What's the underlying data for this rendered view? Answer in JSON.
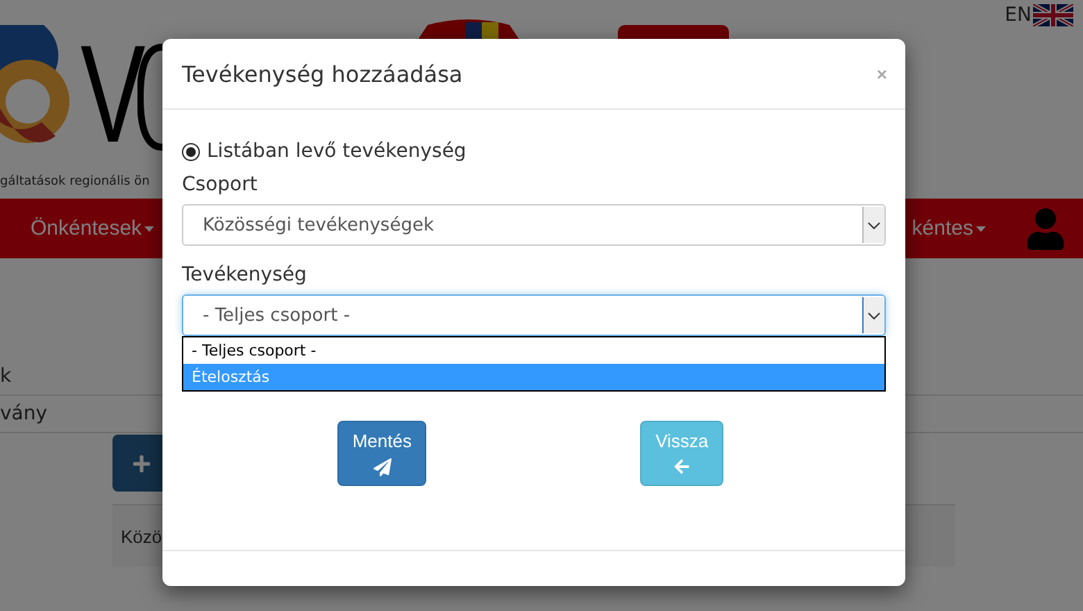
{
  "page": {
    "language": "EN",
    "logo_text": "V",
    "tagline": "gáltatások regionális ön",
    "nav": [
      {
        "label": "Önkéntesek"
      },
      {
        "label": "kéntes"
      }
    ],
    "rows": [
      "k",
      "vány"
    ],
    "panel_text": "Közö"
  },
  "dialog": {
    "title": "Tevékenység hozzáadása",
    "close": "×",
    "radio": {
      "label": "Listában levő tevékenység",
      "selected": true
    },
    "fields": [
      {
        "label": "Csoport",
        "value": "Közösségi tevékenységek",
        "focused": false
      },
      {
        "label": "Tevékenység",
        "value": "- Teljes csoport -",
        "focused": true,
        "options": [
          {
            "label": "- Teljes csoport -",
            "highlighted": false
          },
          {
            "label": "Ételosztás",
            "highlighted": true
          }
        ]
      }
    ],
    "buttons": [
      {
        "label": "Mentés",
        "kind": "primary"
      },
      {
        "label": "Vissza",
        "kind": "info"
      }
    ]
  }
}
